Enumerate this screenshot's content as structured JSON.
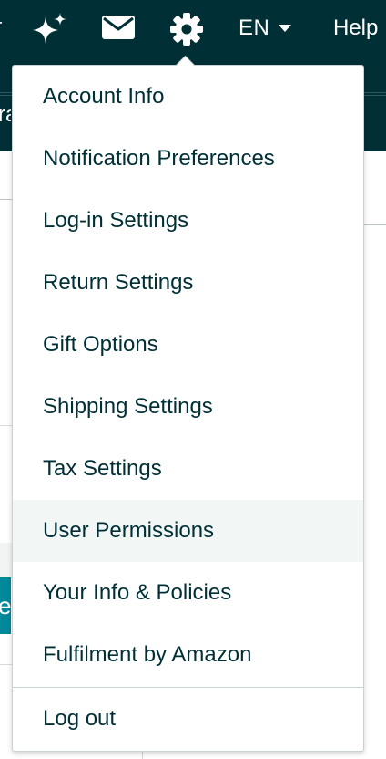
{
  "topbar": {
    "clipped_left_text": "n",
    "language": "EN",
    "help_label": "Help",
    "icons": [
      "sparkle-icon",
      "mail-icon",
      "gear-icon",
      "chevron-down-icon"
    ]
  },
  "subbar": {
    "peek_text": "ra"
  },
  "background": {
    "teal_button_peek": "e"
  },
  "menu": {
    "items": [
      {
        "label": "Account Info"
      },
      {
        "label": "Notification Preferences"
      },
      {
        "label": "Log-in Settings"
      },
      {
        "label": "Return Settings"
      },
      {
        "label": "Gift Options"
      },
      {
        "label": "Shipping Settings"
      },
      {
        "label": "Tax Settings"
      },
      {
        "label": "User Permissions"
      },
      {
        "label": "Your Info & Policies"
      },
      {
        "label": "Fulfilment by Amazon"
      }
    ],
    "logout_label": "Log out",
    "hovered_item": "User Permissions"
  },
  "colors": {
    "header_bg": "#002f36",
    "menu_text": "#002f36",
    "hover_bg": "#f2f7f6",
    "accent_teal": "#00889b"
  }
}
